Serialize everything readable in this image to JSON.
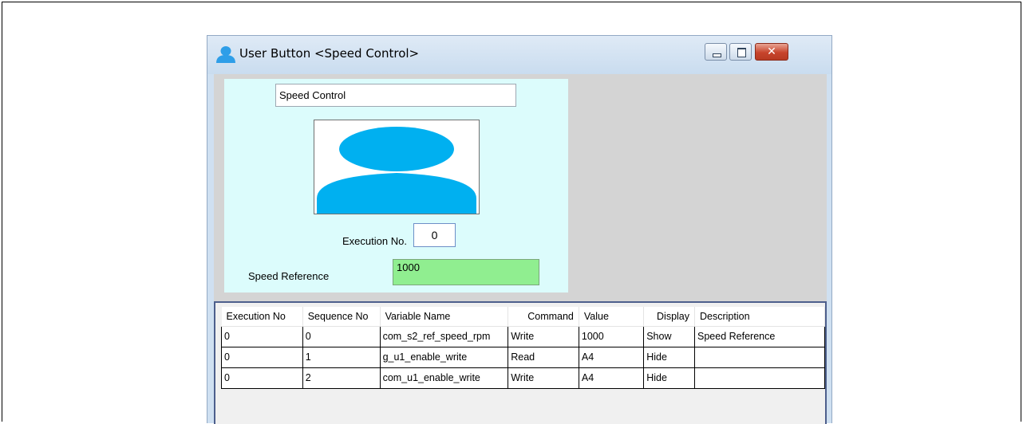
{
  "window": {
    "title": "User Button <Speed Control>",
    "icons": {
      "title": "user-icon",
      "minimize": "minimize-icon",
      "maximize": "maximize-icon",
      "close": "close-icon"
    },
    "close_glyph": "✕"
  },
  "panel": {
    "button_name": "Speed Control",
    "avatar_icon": "user-silhouette-icon",
    "execution_label": "Execution No.",
    "execution_value": "0",
    "speed_label": "Speed Reference",
    "speed_value": "1000",
    "colors": {
      "panel_bg": "#dcfcfc",
      "speed_field_bg": "#90ee90",
      "avatar": "#00b0f0"
    }
  },
  "table": {
    "columns": [
      "Execution No",
      "Sequence No",
      "Variable Name",
      "Command",
      "Value",
      "Display",
      "Description"
    ],
    "rows": [
      [
        "0",
        "0",
        "com_s2_ref_speed_rpm",
        "Write",
        "1000",
        "Show",
        "Speed Reference"
      ],
      [
        "0",
        "1",
        "g_u1_enable_write",
        "Read",
        "A4",
        "Hide",
        ""
      ],
      [
        "0",
        "2",
        "com_u1_enable_write",
        "Write",
        "A4",
        "Hide",
        ""
      ]
    ]
  }
}
